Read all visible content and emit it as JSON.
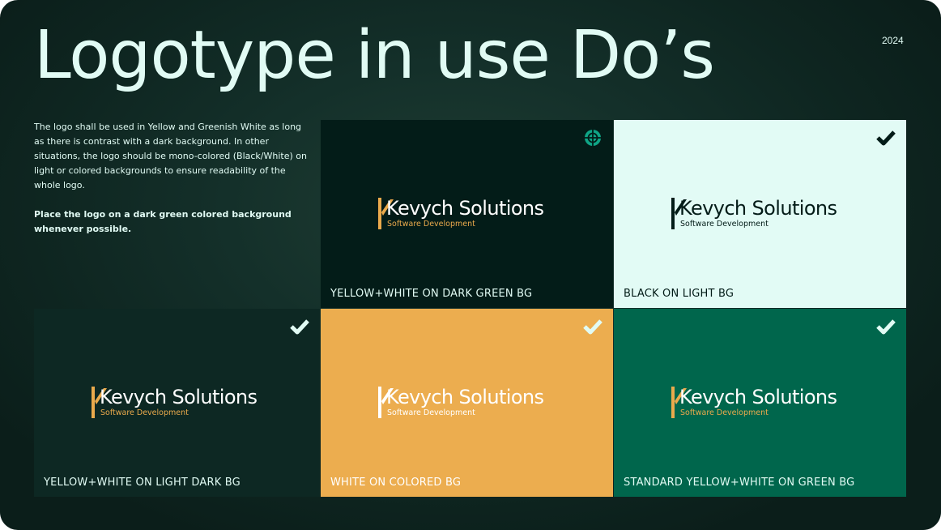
{
  "slide": {
    "title": "Logotype in use Do’s",
    "year": "2024",
    "description": "The logo shall be used in Yellow and Greenish White as long as there is contrast with a dark background. In other situations, the logo should be mono-colored (Black/White) on light or colored backgrounds to ensure readability of the whole logo.",
    "description_bold": "Place the logo on a dark green colored background whenever possible."
  },
  "logo": {
    "brand": "Kevych Solutions",
    "tagline": "Software Development"
  },
  "colors": {
    "slide_bg": "#0e2520",
    "text_light": "#e1fbf4",
    "brand_yellow": "#eaaa4c",
    "dark_green": "#031c18",
    "light_bg": "#e2fbf5",
    "light_dark": "#0d2823",
    "colored_bg": "#ecad4f",
    "green_bg": "#00664c",
    "target_icon": "#0fa586"
  },
  "tiles": [
    {
      "label": "YELLOW+WHITE ON DARK GREEN BG",
      "icon": "target-icon"
    },
    {
      "label": "BLACK ON LIGHT BG",
      "icon": "check-icon"
    },
    {
      "label": "YELLOW+WHITE ON LIGHT DARK BG",
      "icon": "check-icon"
    },
    {
      "label": "WHITE ON COLORED BG",
      "icon": "check-icon"
    },
    {
      "label": "STANDARD YELLOW+WHITE ON GREEN BG",
      "icon": "check-icon"
    }
  ]
}
